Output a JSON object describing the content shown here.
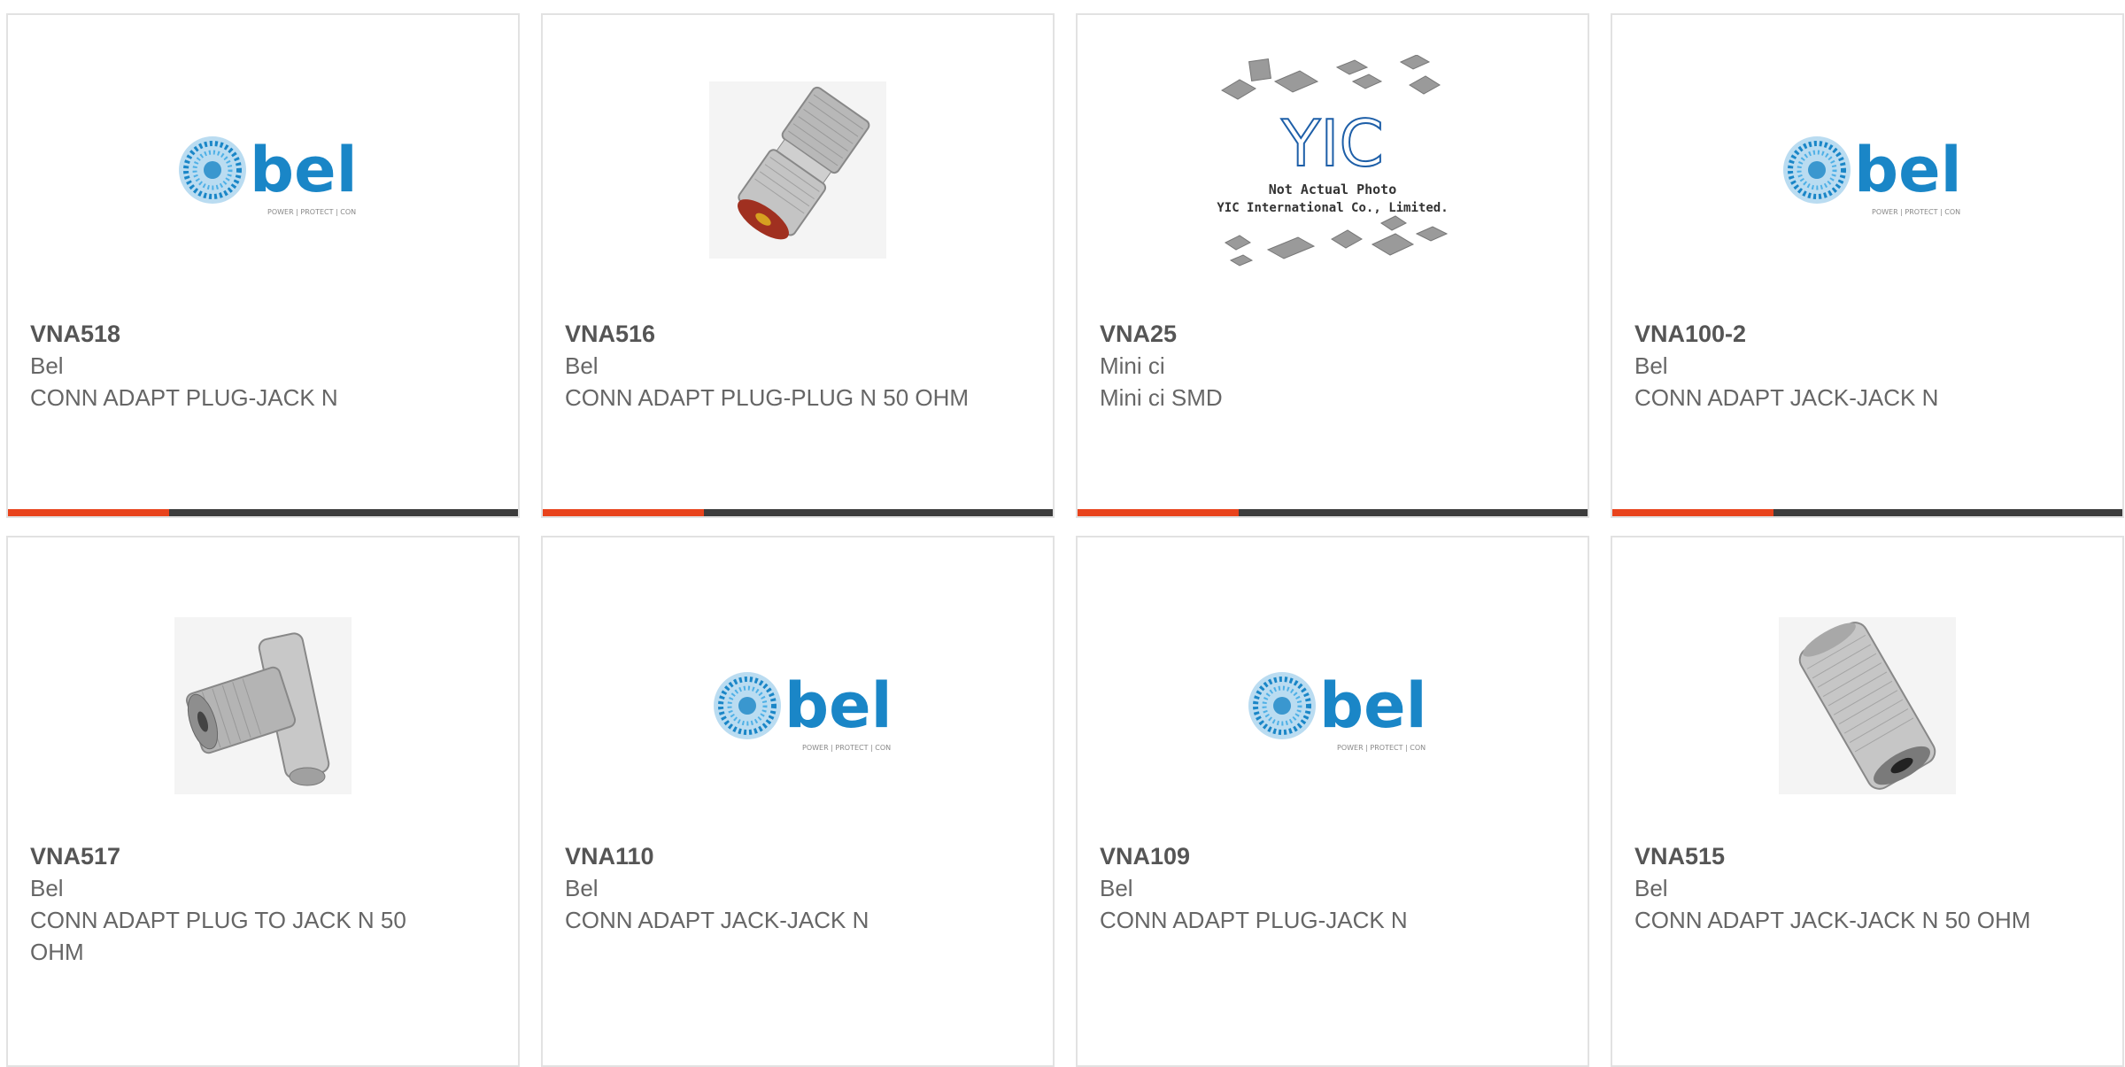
{
  "colors": {
    "accent": "#e8431c",
    "dark_bar": "#3c3c3c",
    "bel_blue": "#1a86c7"
  },
  "logo": {
    "bel_text": "bel",
    "bel_tagline": "POWER | PROTECT | CONNECT"
  },
  "yic_placeholder": {
    "logo_text": "YIC",
    "line1": "Not Actual Photo",
    "line2": "YIC International Co., Limited."
  },
  "products": [
    {
      "part": "VNA518",
      "manufacturer": "Bel",
      "description": "CONN ADAPT PLUG-JACK N",
      "image": "bel-logo"
    },
    {
      "part": "VNA516",
      "manufacturer": "Bel",
      "description": "CONN ADAPT PLUG-PLUG N 50 OHM",
      "image": "n-plug-plug-adapter"
    },
    {
      "part": "VNA25",
      "manufacturer": "Mini ci",
      "description": "Mini ci SMD",
      "image": "yic-placeholder"
    },
    {
      "part": "VNA100-2",
      "manufacturer": "Bel",
      "description": "CONN ADAPT JACK-JACK N",
      "image": "bel-logo"
    },
    {
      "part": "VNA517",
      "manufacturer": "Bel",
      "description": "CONN ADAPT PLUG TO JACK N 50 OHM",
      "image": "n-right-angle-adapter"
    },
    {
      "part": "VNA110",
      "manufacturer": "Bel",
      "description": "CONN ADAPT JACK-JACK N",
      "image": "bel-logo"
    },
    {
      "part": "VNA109",
      "manufacturer": "Bel",
      "description": "CONN ADAPT PLUG-JACK N",
      "image": "bel-logo"
    },
    {
      "part": "VNA515",
      "manufacturer": "Bel",
      "description": "CONN ADAPT JACK-JACK N 50 OHM",
      "image": "n-jack-jack-adapter"
    }
  ]
}
